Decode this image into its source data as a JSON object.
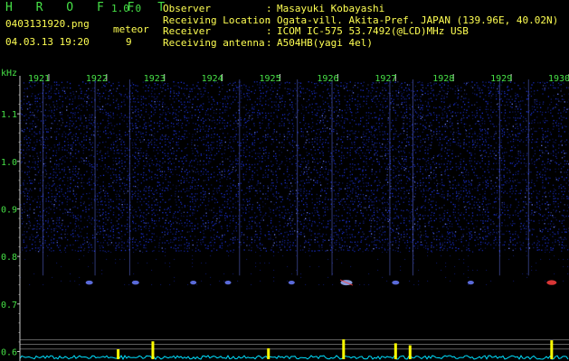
{
  "header": {
    "app_title": "H R O F F T",
    "app_version": "1.0.0",
    "filename": "0403131920.png",
    "datetime": "04.03.13 19:20",
    "meteor_label": "meteor",
    "meteor_count": "9",
    "info": [
      {
        "key": "Observer",
        "value": "Masayuki Kobayashi"
      },
      {
        "key": "Receiving Location",
        "value": "Ogata-vill. Akita-Pref. JAPAN (139.96E, 40.02N)"
      },
      {
        "key": "Receiver",
        "value": "ICOM IC-575 53.7492(@LCD)MHz USB"
      },
      {
        "key": "Receiving antenna",
        "value": "A504HB(yagi 4el)"
      }
    ]
  },
  "colors": {
    "background": "#000000",
    "label_green": "#46e046",
    "header_yellow": "#ffff52",
    "noise_blue": "#1a2fd0",
    "noise_bright": "#6a7dff",
    "meteor_ping": "#a0b4ff",
    "meteor_red": "#ff4040",
    "spectrum_cyan": "#00e0ff",
    "spectrum_yellow": "#ffff00",
    "grid_white": "#c8c8c8"
  },
  "chart_data": {
    "type": "heatmap",
    "title": "",
    "xlabel": "",
    "ylabel": "kHz",
    "x_ticks": [
      "1921",
      "1922",
      "1923",
      "1924",
      "1925",
      "1926",
      "1927",
      "1928",
      "1929",
      "1930"
    ],
    "y_ticks": [
      "1.1",
      "1.0",
      "0.9",
      "0.8",
      "0.7",
      "0.6"
    ],
    "ylim": [
      0.58,
      1.18
    ],
    "xlim": [
      1920.5,
      1930.0
    ],
    "noise_floor_khz": 0.81,
    "meteors": [
      {
        "minute": 1921.7,
        "khz": 0.745,
        "strength": 0.5,
        "color": "blue"
      },
      {
        "minute": 1922.5,
        "khz": 0.745,
        "strength": 0.5,
        "color": "blue"
      },
      {
        "minute": 1923.5,
        "khz": 0.745,
        "strength": 0.4,
        "color": "blue"
      },
      {
        "minute": 1924.1,
        "khz": 0.745,
        "strength": 0.4,
        "color": "blue"
      },
      {
        "minute": 1925.2,
        "khz": 0.745,
        "strength": 0.4,
        "color": "blue"
      },
      {
        "minute": 1926.15,
        "khz": 0.745,
        "strength": 1.0,
        "color": "bright"
      },
      {
        "minute": 1927.0,
        "khz": 0.745,
        "strength": 0.5,
        "color": "blue"
      },
      {
        "minute": 1928.3,
        "khz": 0.745,
        "strength": 0.4,
        "color": "blue"
      },
      {
        "minute": 1929.7,
        "khz": 0.745,
        "strength": 0.8,
        "color": "red"
      }
    ],
    "vertical_streaks_minute": [
      1920.9,
      1921.8,
      1922.4,
      1924.3,
      1925.3,
      1925.9,
      1926.9,
      1927.3,
      1928.8,
      1929.3
    ],
    "spectrum_peaks": [
      {
        "minute": 1922.2,
        "level": 0.5
      },
      {
        "minute": 1922.8,
        "level": 0.9
      },
      {
        "minute": 1924.8,
        "level": 0.55
      },
      {
        "minute": 1926.1,
        "level": 1.0
      },
      {
        "minute": 1927.0,
        "level": 0.8
      },
      {
        "minute": 1927.25,
        "level": 0.7
      },
      {
        "minute": 1929.7,
        "level": 0.95
      }
    ],
    "reference_lines_khz": [
      0.625,
      0.615,
      0.605
    ]
  }
}
